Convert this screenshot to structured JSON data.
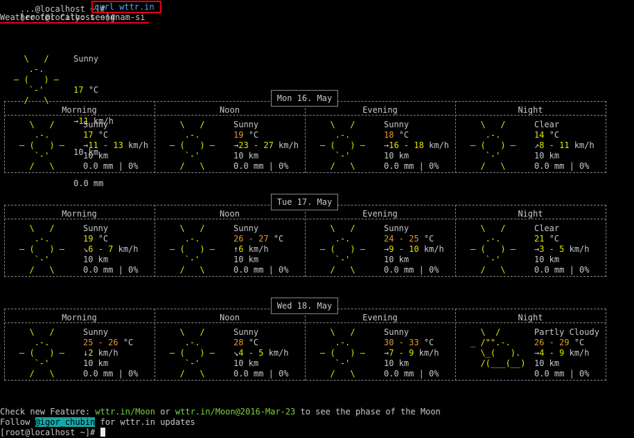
{
  "prompt": "[root@localhost ~]# ",
  "prompt_partial_top": "...@localhost ~]# ",
  "command": "curl wttr.in",
  "title": "Weather for City: seongnam-si",
  "current": {
    "icon": [
      "  \\   /  ",
      "   .-.   ",
      "― (   ) ―",
      "   `-'   ",
      "  /   \\  "
    ],
    "condition": "Sunny",
    "temp": "17",
    "unit": "°C",
    "wind_arrow": "→",
    "wind": "11",
    "wind_unit": "km/h",
    "visibility": "10 km",
    "precip": "0.0 mm"
  },
  "phases": [
    "Morning",
    "Noon",
    "Evening",
    "Night"
  ],
  "days": [
    {
      "label": "Mon 16. May",
      "cells": [
        {
          "icon": "sun",
          "cond": "Sunny",
          "temp": "17",
          "wind_arrow": "→",
          "wind": "11 - 13",
          "vis": "10 km",
          "precip": "0.0 mm | 0%"
        },
        {
          "icon": "sun",
          "cond": "Sunny",
          "temp": "19",
          "wind_arrow": "→",
          "wind": "23 - 27",
          "vis": "10 km",
          "precip": "0.0 mm | 0%"
        },
        {
          "icon": "sun",
          "cond": "Sunny",
          "temp": "18",
          "wind_arrow": "→",
          "wind": "16 - 18",
          "vis": "10 km",
          "precip": "0.0 mm | 0%"
        },
        {
          "icon": "sun",
          "cond": "Clear",
          "temp": "14",
          "wind_arrow": "↗",
          "wind": "8 - 11",
          "vis": "10 km",
          "precip": "0.0 mm | 0%"
        }
      ]
    },
    {
      "label": "Tue 17. May",
      "cells": [
        {
          "icon": "sun",
          "cond": "Sunny",
          "temp": "19",
          "wind_arrow": "↘",
          "wind": "6 - 7",
          "vis": "10 km",
          "precip": "0.0 mm | 0%"
        },
        {
          "icon": "sun",
          "cond": "Sunny",
          "temp": "26 - 27",
          "wind_arrow": "↑",
          "wind": "6",
          "vis": "10 km",
          "precip": "0.0 mm | 0%"
        },
        {
          "icon": "sun",
          "cond": "Sunny",
          "temp": "24 - 25",
          "wind_arrow": "→",
          "wind": "9 - 10",
          "vis": "10 km",
          "precip": "0.0 mm | 0%"
        },
        {
          "icon": "sun",
          "cond": "Clear",
          "temp": "21",
          "wind_arrow": "→",
          "wind": "3 - 5",
          "vis": "10 km",
          "precip": "0.0 mm | 0%"
        }
      ]
    },
    {
      "label": "Wed 18. May",
      "cells": [
        {
          "icon": "sun",
          "cond": "Sunny",
          "temp": "25 - 26",
          "wind_arrow": "↓",
          "wind": "2",
          "vis": "10 km",
          "precip": "0.0 mm | 0%"
        },
        {
          "icon": "sun",
          "cond": "Sunny",
          "temp": "28",
          "wind_arrow": "↘",
          "wind": "4 - 5",
          "vis": "10 km",
          "precip": "0.0 mm | 0%"
        },
        {
          "icon": "sun",
          "cond": "Sunny",
          "temp": "30 - 33",
          "wind_arrow": "→",
          "wind": "7 - 9",
          "vis": "10 km",
          "precip": "0.0 mm | 0%"
        },
        {
          "icon": "cloud",
          "cond": "Partly Cloudy",
          "temp": "26 - 29",
          "wind_arrow": "→",
          "wind": "4 - 9",
          "vis": "10 km",
          "precip": "0.0 mm | 0%"
        }
      ]
    }
  ],
  "icons": {
    "sun": [
      "  \\   /  ",
      "   .-.   ",
      "― (   ) ―",
      "   `-'   ",
      "  /   \\  "
    ],
    "cloud": [
      "  \\  /",
      "_ /\"\".-.",
      "  \\_(   ).",
      "  /(___(__)",
      ""
    ]
  },
  "footer": {
    "line1_pre": "Check new Feature: ",
    "link1": "wttr.in/Moon",
    "line1_mid": " or ",
    "link2": "wttr.in/Moon@2016-Mar-23",
    "line1_post": " to see the phase of the Moon",
    "line2_pre": "Follow ",
    "handle": "@igor_chubin",
    "line2_post": " for wttr.in updates"
  },
  "colors": {
    "yellow": "#e5e500",
    "orange": "#e59a2a",
    "green": "#7cd23c",
    "link_blue": "#4aa8ff",
    "highlight_red": "#e0001b",
    "handle_bg": "#14a8a8"
  }
}
